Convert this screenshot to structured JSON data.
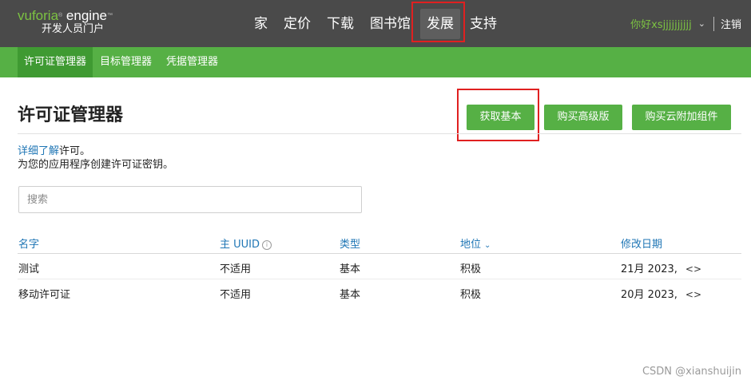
{
  "header": {
    "logo_brand": "vuforia",
    "logo_tm": "®",
    "logo_engine": " engine",
    "logo_engine_tm": "™",
    "logo_subtitle": "开发人员门户",
    "nav": [
      "家",
      "定价",
      "下载",
      "图书馆",
      "发展",
      "支持"
    ],
    "active_nav_index": 4,
    "user_greeting": "你好xsjjjjjjjjjj",
    "logout": "注销"
  },
  "subnav": {
    "items": [
      "许可证管理器",
      "目标管理器",
      "凭据管理器"
    ],
    "active_index": 0
  },
  "page": {
    "title": "许可证管理器",
    "buttons": {
      "get_basic": "获取基本",
      "buy_premium": "购买高级版",
      "buy_cloud_addon": "购买云附加组件"
    },
    "desc_link": "详细了解",
    "desc_after_link": "许可。",
    "desc_line2": "为您的应用程序创建许可证密钥。",
    "search_placeholder": "搜索"
  },
  "table": {
    "headers": {
      "name": "名字",
      "uuid": "主 UUID",
      "uuid_info_glyph": "i",
      "type": "类型",
      "status": "地位",
      "modified": "修改日期"
    },
    "rows": [
      {
        "name": "测试",
        "uuid": "不适用",
        "type": "基本",
        "status": "积极",
        "modified": "21月 2023,",
        "action": "<>"
      },
      {
        "name": "移动许可证",
        "uuid": "不适用",
        "type": "基本",
        "status": "积极",
        "modified": "20月 2023,",
        "action": "<>"
      }
    ]
  },
  "watermark": "CSDN @xianshuijin",
  "colors": {
    "header_bg": "#4a4a4a",
    "accent_green": "#56b045",
    "link_blue": "#1f76b5",
    "highlight_red": "#e02020"
  }
}
